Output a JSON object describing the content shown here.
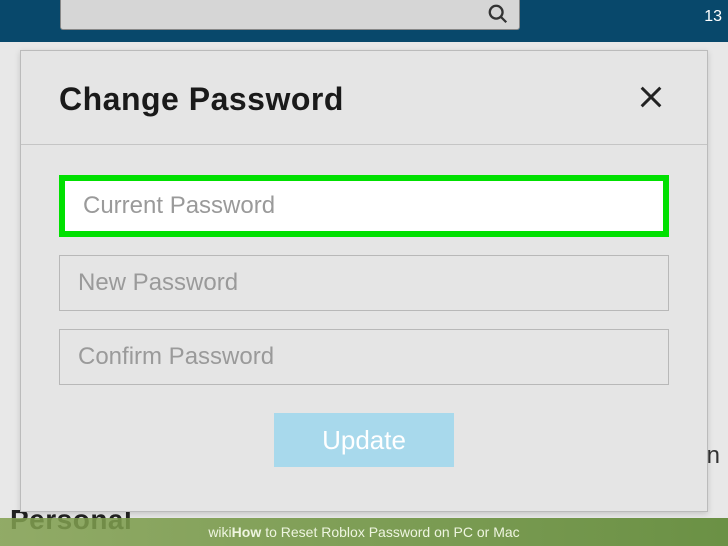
{
  "topbar": {
    "right_text": "13"
  },
  "background": {
    "bottom_left": "Personal",
    "right_char": "n"
  },
  "modal": {
    "title": "Change Password",
    "inputs": {
      "current": {
        "placeholder": "Current Password",
        "value": ""
      },
      "new": {
        "placeholder": "New Password",
        "value": ""
      },
      "confirm": {
        "placeholder": "Confirm Password",
        "value": ""
      }
    },
    "update_label": "Update"
  },
  "watermark": {
    "brand_wiki": "wiki",
    "brand_how": "How",
    "article": " to Reset Roblox Password on PC or Mac"
  }
}
